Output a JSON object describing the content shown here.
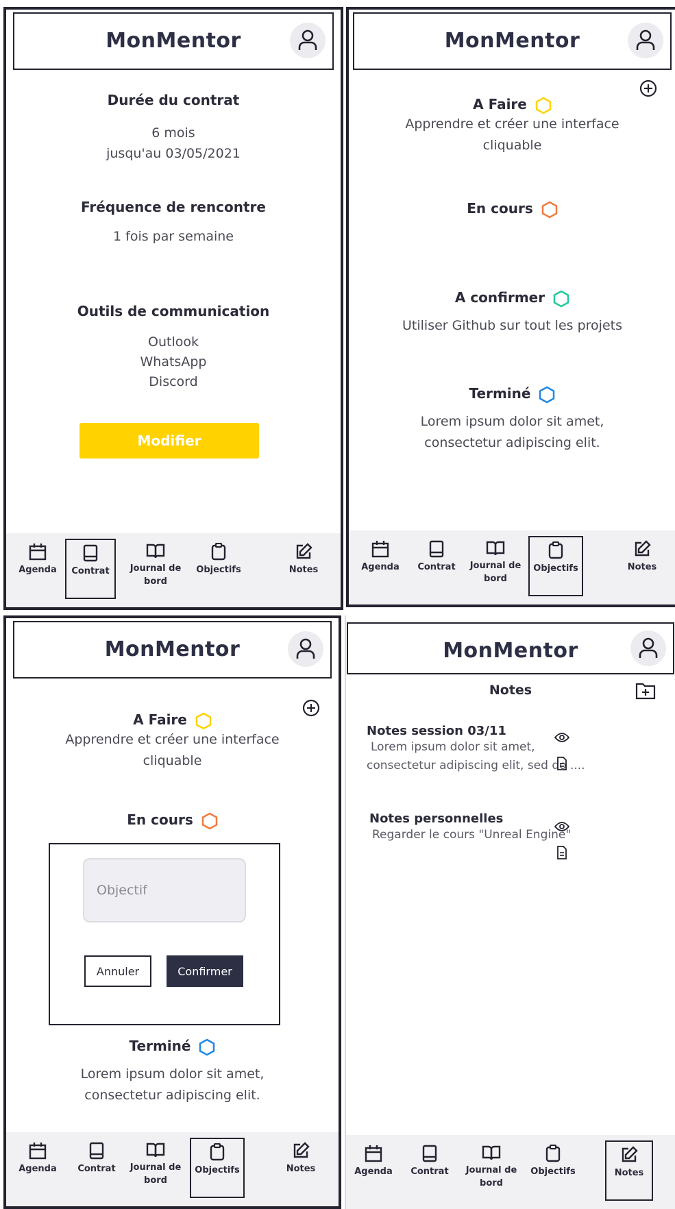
{
  "app": {
    "title": "MonMentor"
  },
  "nav": {
    "agenda": "Agenda",
    "contrat": "Contrat",
    "journal_line1": "Journal de",
    "journal_line2": "bord",
    "objectifs": "Objectifs",
    "notes": "Notes"
  },
  "contrat": {
    "duree_title": "Durée du contrat",
    "duree_value": "6 mois",
    "duree_until": "jusqu'au 03/05/2021",
    "frequence_title": "Fréquence de rencontre",
    "frequence_value": "1 fois par semaine",
    "outils_title": "Outils de communication",
    "outils": [
      "Outlook",
      "WhatsApp",
      "Discord"
    ],
    "modifier_button": "Modifier"
  },
  "objectifs": {
    "a_faire": {
      "title": "A Faire",
      "line1": "Apprendre et créer une interface",
      "line2": "cliquable",
      "color": "#ffd200"
    },
    "en_cours": {
      "title": "En cours",
      "color": "#f07a3c"
    },
    "a_confirmer": {
      "title": "A confirmer",
      "line1": "Utiliser Github sur tout les projets",
      "color": "#22c99b"
    },
    "termine": {
      "title": "Terminé",
      "line1": "Lorem ipsum dolor sit amet,",
      "line2": "consectetur adipiscing elit.",
      "color": "#1e88e5"
    }
  },
  "modal": {
    "input_placeholder": "Objectif",
    "cancel_button": "Annuler",
    "confirm_button": "Confirmer"
  },
  "notes": {
    "title": "Notes",
    "items": [
      {
        "title": "Notes session 03/11",
        "line1": "Lorem ipsum dolor sit amet,",
        "line2": "consectetur adipiscing elit, sed do ...."
      },
      {
        "title": "Notes personnelles",
        "line1": "Regarder le cours \"Unreal Engine\""
      }
    ]
  }
}
